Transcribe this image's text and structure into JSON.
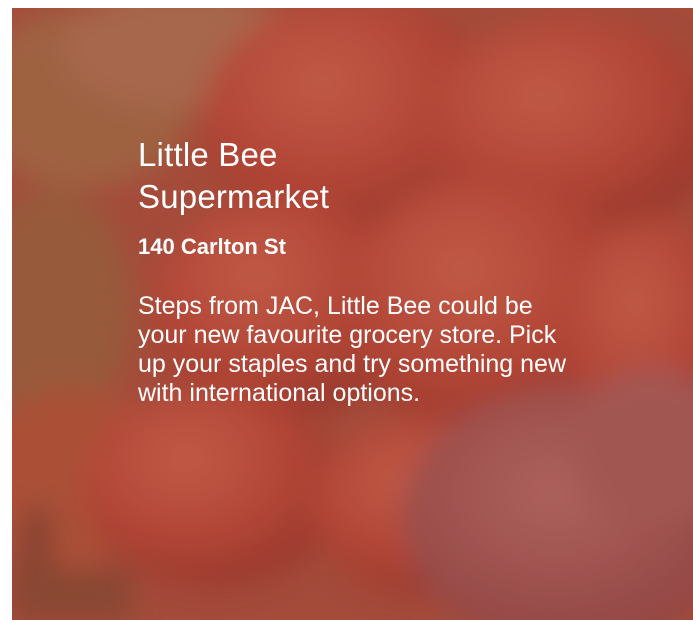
{
  "card": {
    "title": "Little Bee Supermarket",
    "address": "140 Carlton St",
    "description": "Steps from JAC, Little Bee could be your new favourite grocery store. Pick up your staples and try something new with international options.",
    "background_image": "produce-photo",
    "overlay_color": "#963e32"
  }
}
